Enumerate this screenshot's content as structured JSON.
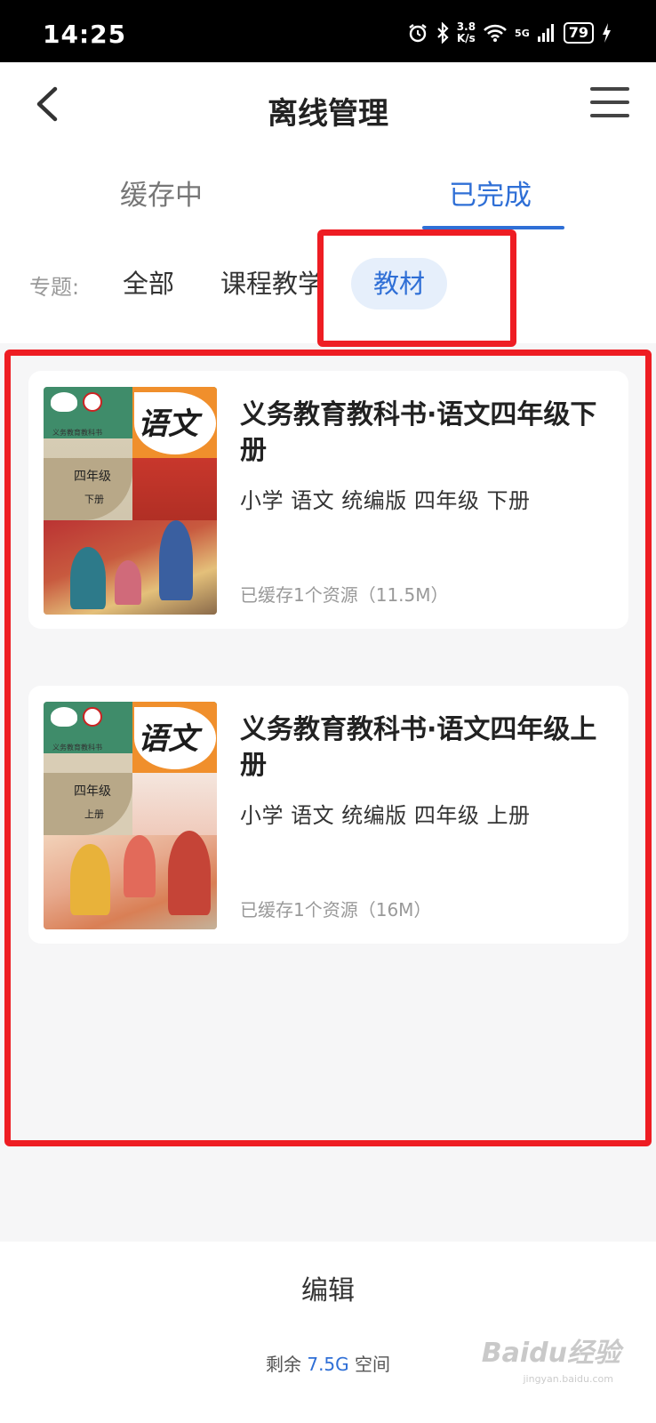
{
  "status_bar": {
    "time": "14:25",
    "net_speed_value": "3.8",
    "net_speed_unit": "K/s",
    "network": "5G",
    "battery": "79"
  },
  "header": {
    "title": "离线管理",
    "back_icon": "chevron-left-icon",
    "menu_icon": "menu-icon"
  },
  "tabs": [
    {
      "label": "缓存中",
      "active": false
    },
    {
      "label": "已完成",
      "active": true
    }
  ],
  "filter": {
    "label": "专题:",
    "chips": [
      {
        "label": "全部",
        "selected": false
      },
      {
        "label": "课程教学",
        "selected": false
      },
      {
        "label": "教材",
        "selected": true
      }
    ]
  },
  "books": [
    {
      "title": "义务教育教科书·语文四年级下册",
      "meta": "小学 语文 统编版 四年级 下册",
      "cache_info": "已缓存1个资源（11.5M）",
      "cover": {
        "subject": "语文",
        "grade": "四年级",
        "volume": "下册",
        "series": "义务教育教科书"
      }
    },
    {
      "title": "义务教育教科书·语文四年级上册",
      "meta": "小学 语文 统编版 四年级 上册",
      "cache_info": "已缓存1个资源（16M）",
      "cover": {
        "subject": "语文",
        "grade": "四年级",
        "volume": "上册",
        "series": "义务教育教科书"
      }
    }
  ],
  "bottom": {
    "edit_label": "编辑",
    "storage_prefix": "剩余",
    "storage_value": "7.5G",
    "storage_suffix": "空间"
  },
  "watermark": {
    "brand": "Baidu经验",
    "url": "jingyan.baidu.com"
  },
  "colors": {
    "accent": "#2f6fd6",
    "highlight": "#ee1d23",
    "chip_bg": "#e6effb"
  }
}
